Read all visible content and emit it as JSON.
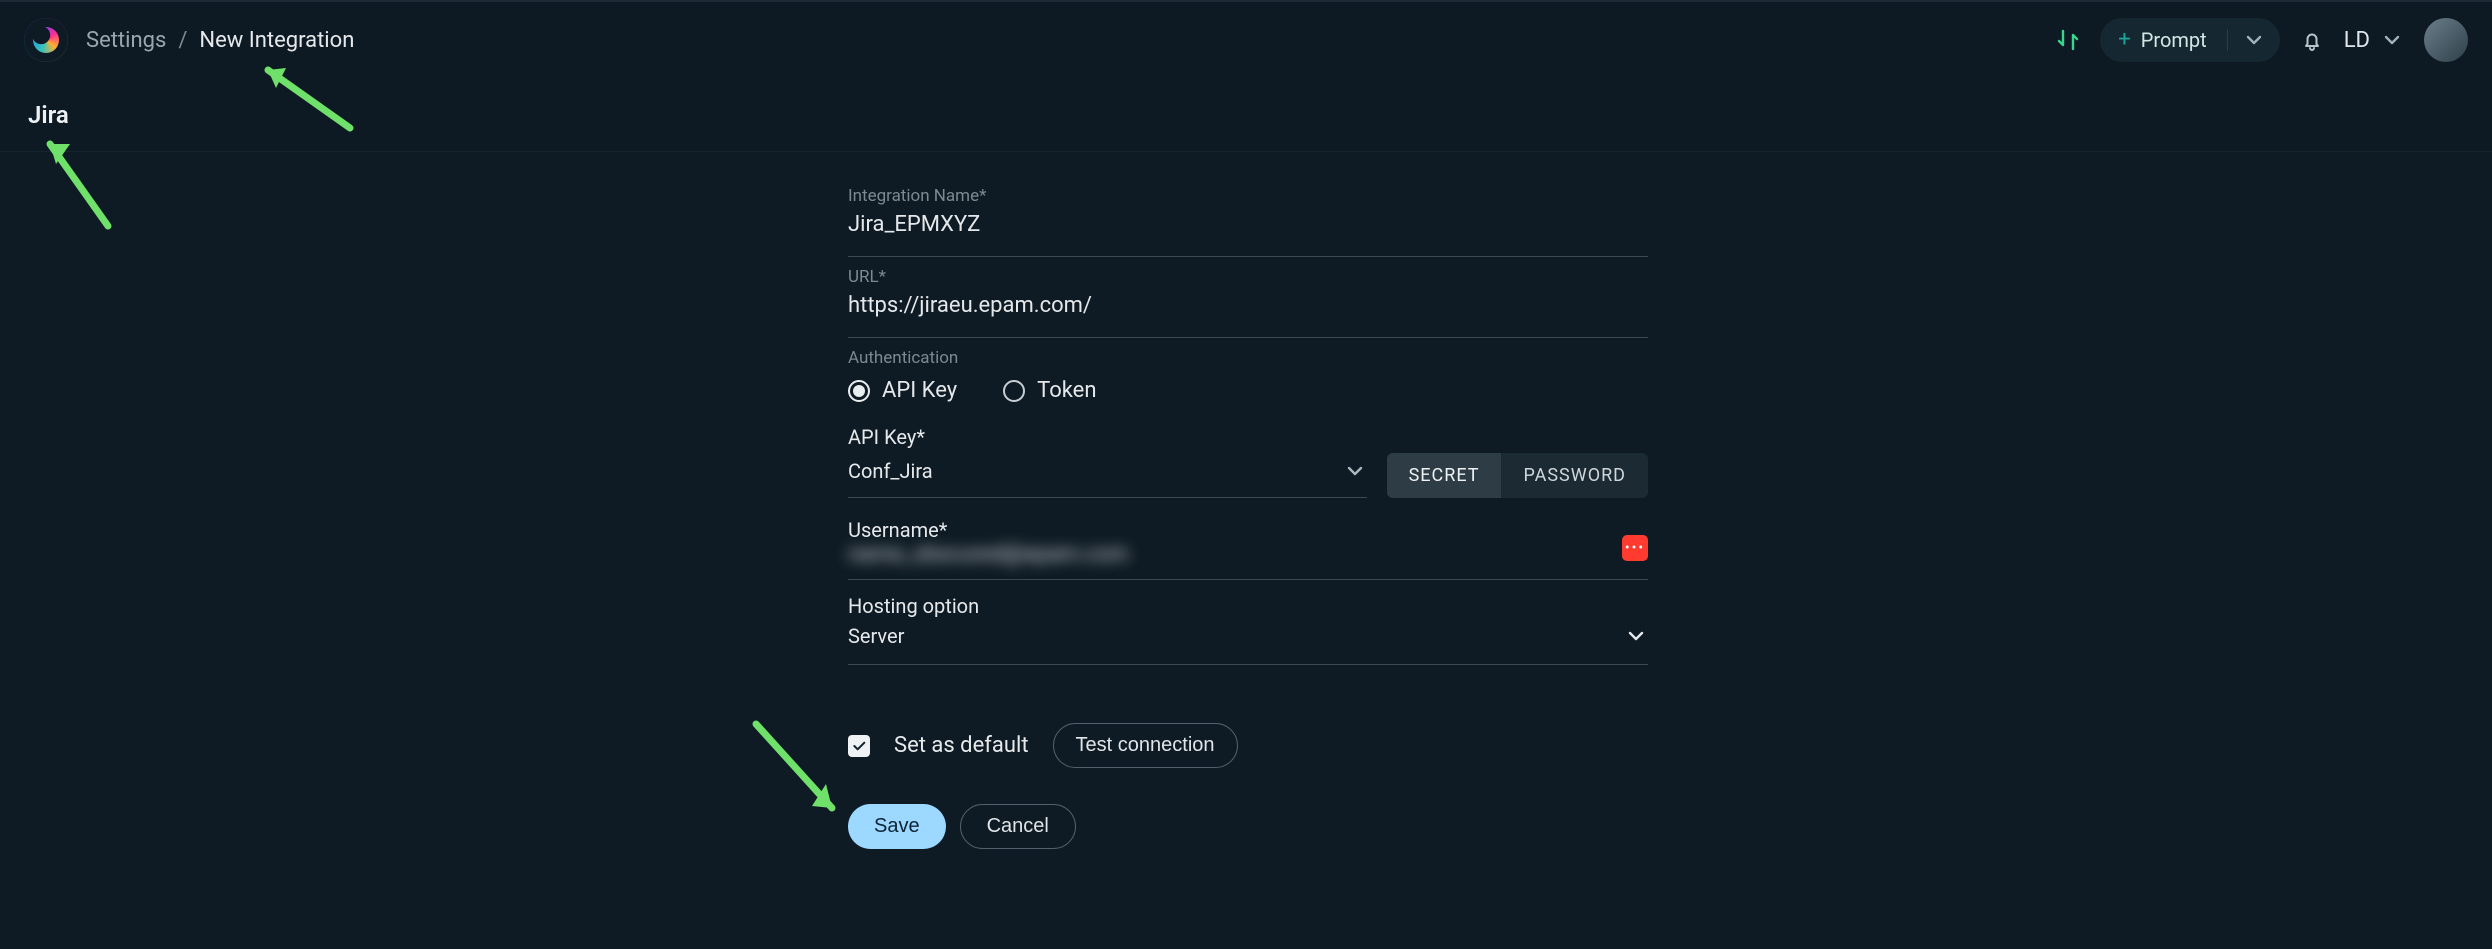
{
  "breadcrumbs": {
    "root": "Settings",
    "current": "New Integration"
  },
  "page_title": "Jira",
  "topbar": {
    "prompt_label": "Prompt",
    "user_initials": "LD"
  },
  "form": {
    "integration_name": {
      "label": "Integration Name",
      "required": "*",
      "value": "Jira_EPMXYZ"
    },
    "url": {
      "label": "URL",
      "required": "*",
      "value": "https://jiraeu.epam.com/"
    },
    "authentication": {
      "label": "Authentication",
      "options": {
        "api_key": "API Key",
        "token": "Token"
      },
      "selected": "api_key"
    },
    "api_key": {
      "label": "API Key",
      "required": "*",
      "value": "Conf_Jira",
      "segments": {
        "secret": "SECRET",
        "password": "PASSWORD"
      },
      "segment_selected": "secret"
    },
    "username": {
      "label": "Username",
      "required": "*",
      "value_obscured": "name_obscured@epam.com"
    },
    "hosting": {
      "label": "Hosting option",
      "value": "Server"
    }
  },
  "controls": {
    "set_default_label": "Set as default",
    "set_default_checked": true,
    "test_connection": "Test connection",
    "save": "Save",
    "cancel": "Cancel"
  }
}
